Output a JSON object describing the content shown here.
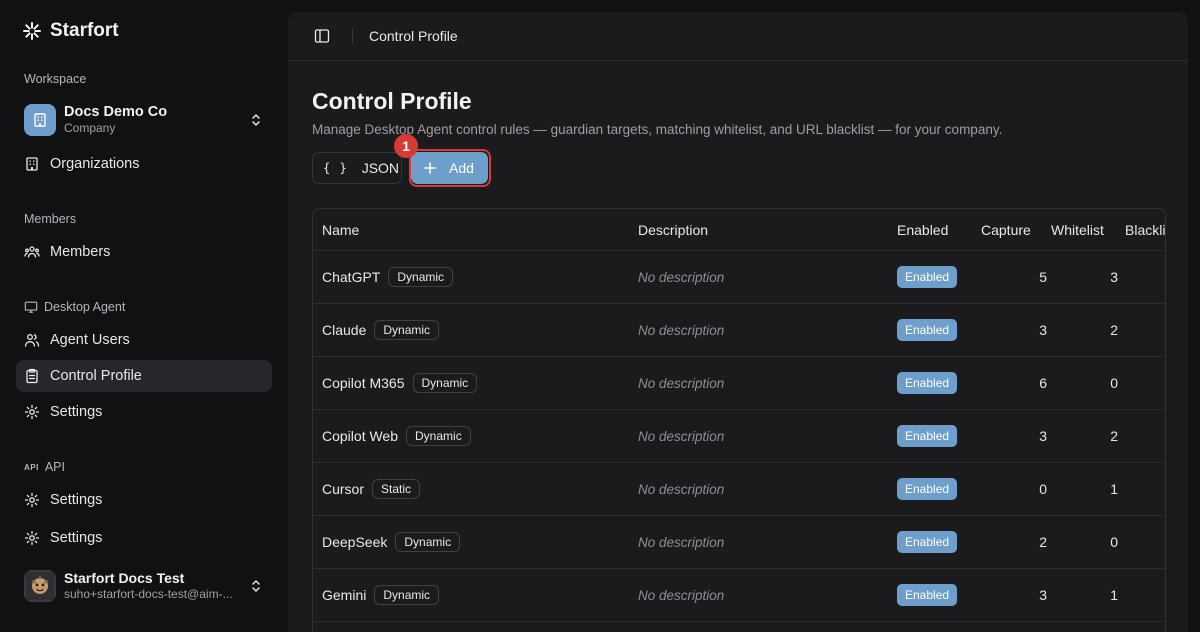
{
  "app": {
    "name": "Starfort"
  },
  "sidebar": {
    "workspace_label": "Workspace",
    "workspace": {
      "name": "Docs Demo Co",
      "type": "Company"
    },
    "organizations_label": "Organizations",
    "members_section": "Members",
    "members_item": "Members",
    "desktop_section": "Desktop Agent",
    "agent_users": "Agent Users",
    "control_profile": "Control Profile",
    "settings_desktop": "Settings",
    "api_badge": "API",
    "api_section": "API",
    "settings_api": "Settings",
    "settings_general": "Settings",
    "user": {
      "name": "Starfort Docs Test",
      "email": "suho+starfort-docs-test@aim-..."
    }
  },
  "topbar": {
    "title": "Control Profile"
  },
  "page": {
    "title": "Control Profile",
    "description": "Manage Desktop Agent control rules — guardian targets, matching whitelist, and URL blacklist — for your company.",
    "json_button": "JSON",
    "json_icon": "{ }",
    "add_button": "Add",
    "step_badge": "1"
  },
  "table": {
    "headers": {
      "name": "Name",
      "description": "Description",
      "enabled": "Enabled",
      "capture": "Capture",
      "whitelist": "Whitelist",
      "blacklist": "Blacklist"
    },
    "rows": [
      {
        "name": "ChatGPT",
        "type": "Dynamic",
        "description": "No description",
        "enabled": "Enabled",
        "capture": "5",
        "whitelist": "3"
      },
      {
        "name": "Claude",
        "type": "Dynamic",
        "description": "No description",
        "enabled": "Enabled",
        "capture": "3",
        "whitelist": "2"
      },
      {
        "name": "Copilot M365",
        "type": "Dynamic",
        "description": "No description",
        "enabled": "Enabled",
        "capture": "6",
        "whitelist": "0"
      },
      {
        "name": "Copilot Web",
        "type": "Dynamic",
        "description": "No description",
        "enabled": "Enabled",
        "capture": "3",
        "whitelist": "2"
      },
      {
        "name": "Cursor",
        "type": "Static",
        "description": "No description",
        "enabled": "Enabled",
        "capture": "0",
        "whitelist": "1"
      },
      {
        "name": "DeepSeek",
        "type": "Dynamic",
        "description": "No description",
        "enabled": "Enabled",
        "capture": "2",
        "whitelist": "0"
      },
      {
        "name": "Gemini",
        "type": "Dynamic",
        "description": "No description",
        "enabled": "Enabled",
        "capture": "3",
        "whitelist": "1"
      }
    ]
  },
  "colors": {
    "accent": "#6e9fcc",
    "highlight": "#d83a35",
    "background": "#111113",
    "panel": "#1b1b1e"
  }
}
